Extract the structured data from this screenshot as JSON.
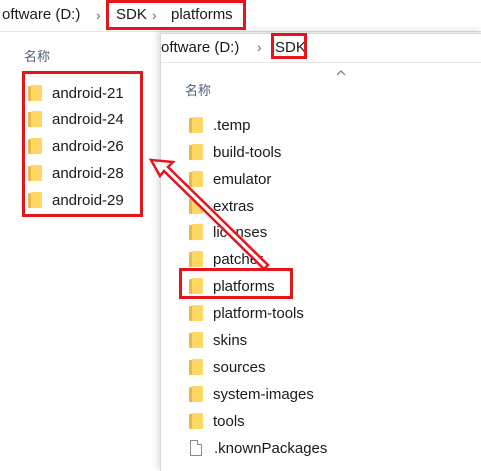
{
  "back_window": {
    "breadcrumb": [
      "oftware (D:)",
      "SDK",
      "platforms"
    ],
    "column_header": "名称",
    "items": [
      {
        "label": "android-21"
      },
      {
        "label": "android-24"
      },
      {
        "label": "android-26"
      },
      {
        "label": "android-28"
      },
      {
        "label": "android-29"
      }
    ]
  },
  "front_window": {
    "breadcrumb": [
      "oftware (D:)",
      "SDK"
    ],
    "column_header": "名称",
    "items": [
      {
        "label": ".temp",
        "type": "folder"
      },
      {
        "label": "build-tools",
        "type": "folder"
      },
      {
        "label": "emulator",
        "type": "folder"
      },
      {
        "label": "extras",
        "type": "folder"
      },
      {
        "label": "licenses",
        "type": "folder"
      },
      {
        "label": "patcher",
        "type": "folder"
      },
      {
        "label": "platforms",
        "type": "folder"
      },
      {
        "label": "platform-tools",
        "type": "folder"
      },
      {
        "label": "skins",
        "type": "folder"
      },
      {
        "label": "sources",
        "type": "folder"
      },
      {
        "label": "system-images",
        "type": "folder"
      },
      {
        "label": "tools",
        "type": "folder"
      },
      {
        "label": ".knownPackages",
        "type": "file"
      }
    ]
  },
  "colors": {
    "highlight": "#e8141c",
    "folder": "#ffd765",
    "folder_dark": "#e8b84a",
    "header_text": "#4c607a"
  },
  "icons": {
    "separator": "chevron-right-icon",
    "sort": "chevron-up-icon",
    "folder": "folder-icon",
    "file": "file-icon"
  }
}
